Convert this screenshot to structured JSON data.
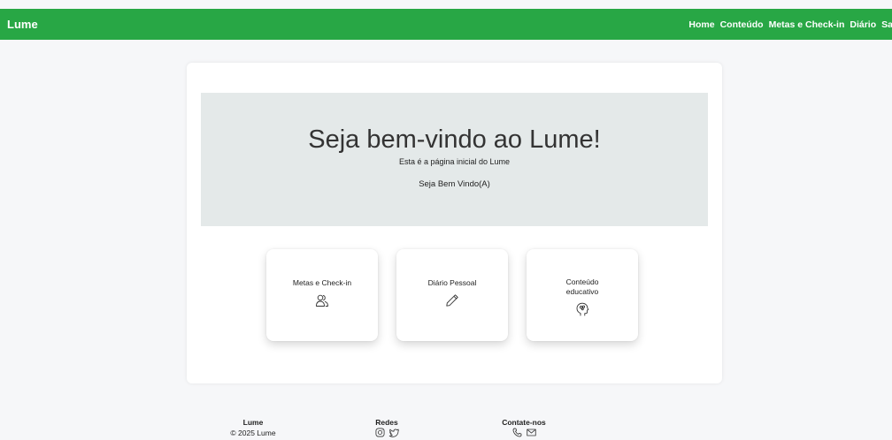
{
  "navbar": {
    "brand": "Lume",
    "links": [
      "Home",
      "Conteúdo",
      "Metas e Check-in",
      "Diário",
      "Sair"
    ]
  },
  "hero": {
    "title": "Seja bem-vindo ao Lume!",
    "subtitle": "Esta é a página inicial do Lume",
    "welcome": "Seja Bem Vindo(A)"
  },
  "features": [
    {
      "label": "Metas e Check-in",
      "icon": "users-icon"
    },
    {
      "label": "Diário Pessoal",
      "icon": "pencil-icon"
    },
    {
      "label": "Conteúdo educativo",
      "icon": "brain-head-icon"
    }
  ],
  "footer": {
    "brand": {
      "title": "Lume",
      "text": "© 2025 Lume"
    },
    "social": {
      "title": "Redes",
      "icons": [
        "instagram-icon",
        "twitter-icon"
      ]
    },
    "contact": {
      "title": "Contate-nos",
      "icons": [
        "phone-icon",
        "mail-icon"
      ]
    }
  },
  "colors": {
    "primary": "#28a745",
    "hero_bg": "#e4e9e9",
    "page_bg": "#f6f7f9"
  }
}
